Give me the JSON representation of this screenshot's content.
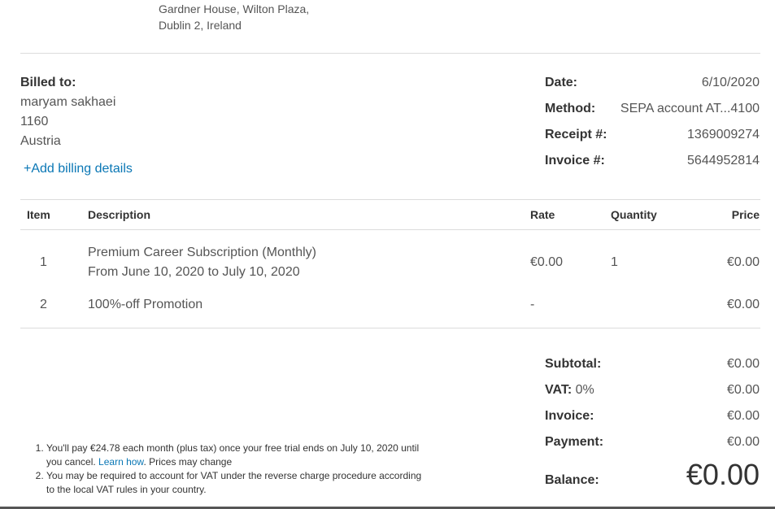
{
  "sender": {
    "address_line1": "Gardner House, Wilton Plaza,",
    "address_line2": "Dublin 2, Ireland"
  },
  "billed_to": {
    "heading": "Billed to:",
    "name": "maryam sakhaei",
    "postal": "1160",
    "country": "Austria",
    "add_billing_icon": "+",
    "add_billing_label": "Add billing details"
  },
  "meta": {
    "date_label": "Date:",
    "date_value": "6/10/2020",
    "method_label": "Method:",
    "method_value": "SEPA account AT...4100",
    "receipt_label": "Receipt #:",
    "receipt_value": "1369009274",
    "invoice_label": "Invoice #:",
    "invoice_value": "5644952814"
  },
  "table": {
    "headers": {
      "item": "Item",
      "description": "Description",
      "rate": "Rate",
      "quantity": "Quantity",
      "price": "Price"
    },
    "rows": [
      {
        "item": "1",
        "description_line1": "Premium Career Subscription (Monthly)",
        "description_line2": "From June 10, 2020 to July 10, 2020",
        "rate": "€0.00",
        "quantity": "1",
        "price": "€0.00"
      },
      {
        "item": "2",
        "description_line1": "100%-off Promotion",
        "rate": "-",
        "quantity": "",
        "price": "€0.00"
      }
    ]
  },
  "totals": {
    "subtotal_label": "Subtotal:",
    "subtotal_value": "€0.00",
    "vat_label": "VAT:",
    "vat_rate": "0%",
    "vat_value": "€0.00",
    "invoice_label": "Invoice:",
    "invoice_value": "€0.00",
    "payment_label": "Payment:",
    "payment_value": "€0.00",
    "balance_label": "Balance:",
    "balance_value": "€0.00"
  },
  "notes": {
    "note1_prefix": "You'll pay €24.78 each month (plus tax) once your free trial ends on July 10, 2020 until you cancel.",
    "note1_link": "Learn how",
    "note1_suffix": ". Prices may change",
    "note2": "You may be required to account for VAT under the reverse charge procedure according to the local VAT rules in your country."
  },
  "colors": {
    "link": "#0a77b5",
    "heading_text": "#333333",
    "body_text": "#555555",
    "divider": "#dcdcdc"
  }
}
